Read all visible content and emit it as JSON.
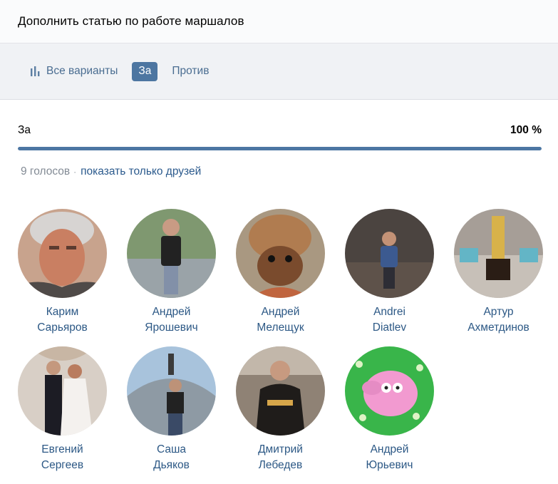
{
  "header": {
    "title": "Дополнить статью по работе маршалов"
  },
  "tabs": [
    {
      "label": "Все варианты",
      "icon": "bar-chart-icon",
      "active": false
    },
    {
      "label": "За",
      "active": true
    },
    {
      "label": "Против",
      "active": false
    }
  ],
  "result": {
    "label": "За",
    "percent_label": "100 %",
    "percent": 100
  },
  "votes": {
    "count_label": "9 голосов",
    "separator": "·",
    "friends_link": "показать только друзей"
  },
  "voters": [
    {
      "first": "Карим",
      "last": "Сарьяров"
    },
    {
      "first": "Андрей",
      "last": "Ярошевич"
    },
    {
      "first": "Андрей",
      "last": "Мелещук"
    },
    {
      "first": "Andrei",
      "last": "Diatlev"
    },
    {
      "first": "Артур",
      "last": "Ахметдинов"
    },
    {
      "first": "Евгений",
      "last": "Сергеев"
    },
    {
      "first": "Саша",
      "last": "Дьяков"
    },
    {
      "first": "Дмитрий",
      "last": "Лебедев"
    },
    {
      "first": "Андрей",
      "last": "Юрьевич"
    }
  ],
  "colors": {
    "accent": "#4d76a1",
    "link": "#2c5885",
    "progress": "#4c76a3"
  }
}
